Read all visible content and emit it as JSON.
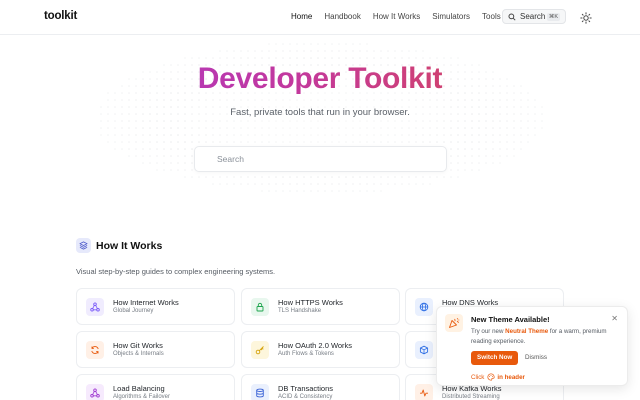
{
  "header": {
    "logo": "toolkit",
    "nav": [
      "Home",
      "Handbook",
      "How It Works",
      "Simulators",
      "Tools"
    ],
    "search_label": "Search",
    "search_shortcut": "⌘K"
  },
  "hero": {
    "title": "Developer Toolkit",
    "subtitle": "Fast, private tools that run in your browser.",
    "search_placeholder": "Search"
  },
  "section": {
    "title": "How It Works",
    "subtitle": "Visual step-by-step guides to complex engineering systems.",
    "cards": [
      {
        "title": "How Internet Works",
        "subtitle": "Global Journey",
        "icon": "network-icon",
        "color": "#7a5af8",
        "bg": "#f0ecfe"
      },
      {
        "title": "How HTTPS Works",
        "subtitle": "TLS Handshake",
        "icon": "lock-icon",
        "color": "#1aa34a",
        "bg": "#e8f7ee"
      },
      {
        "title": "How DNS Works",
        "subtitle": "",
        "icon": "globe-icon",
        "color": "#2f6fe4",
        "bg": "#e9f0fe"
      },
      {
        "title": "How Git Works",
        "subtitle": "Objects & Internals",
        "icon": "git-sync-icon",
        "color": "#e8590c",
        "bg": "#fff0e6"
      },
      {
        "title": "How OAuth 2.0 Works",
        "subtitle": "Auth Flows & Tokens",
        "icon": "key-icon",
        "color": "#d4a106",
        "bg": "#fdf6dc"
      },
      {
        "title": "",
        "subtitle": "",
        "icon": "box-icon",
        "color": "#2f6fe4",
        "bg": "#e9f0fe"
      },
      {
        "title": "Load Balancing",
        "subtitle": "Algorithms & Failover",
        "icon": "network-icon",
        "color": "#a03ad1",
        "bg": "#f6eafd"
      },
      {
        "title": "DB Transactions",
        "subtitle": "ACID & Consistency",
        "icon": "database-icon",
        "color": "#3b63d6",
        "bg": "#eaf0fd"
      },
      {
        "title": "How Kafka Works",
        "subtitle": "Distributed Streaming",
        "icon": "activity-icon",
        "color": "#e8590c",
        "bg": "#fff0e6"
      }
    ]
  },
  "toast": {
    "title": "New Theme Available!",
    "body_prefix": "Try our new ",
    "body_highlight": "Neutral Theme",
    "body_suffix": " for a warm, premium reading experience.",
    "primary_label": "Switch Now",
    "secondary_label": "Dismiss",
    "footer_prefix": "Click",
    "footer_suffix": "in header"
  }
}
